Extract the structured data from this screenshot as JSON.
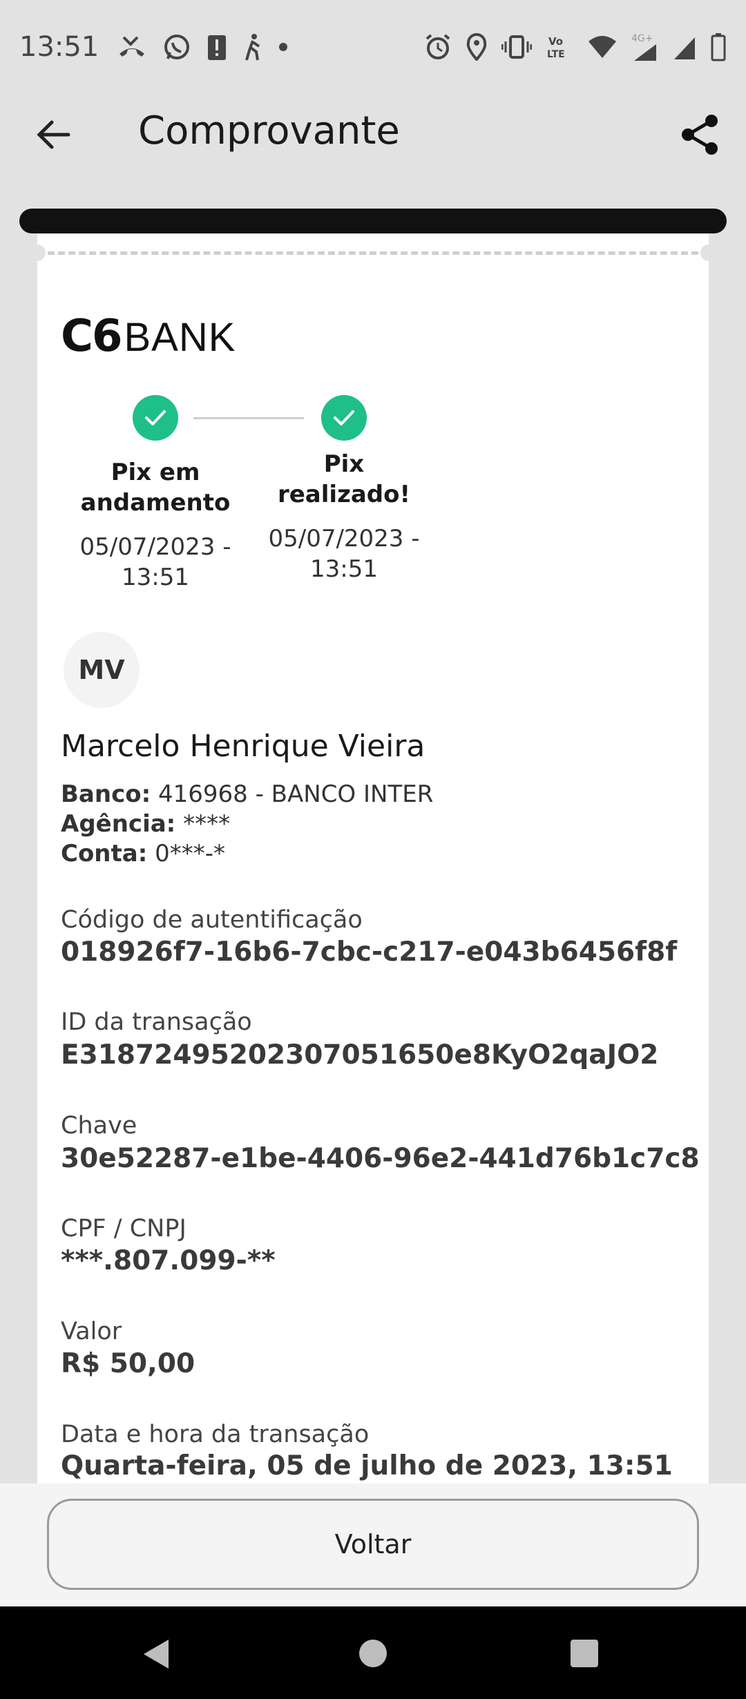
{
  "status_bar": {
    "time": "13:51",
    "left_icons": [
      "missed-call-icon",
      "whatsapp-icon",
      "alert-icon",
      "walking-icon",
      "dot-icon"
    ],
    "right_icons": [
      "alarm-icon",
      "location-icon",
      "vibrate-icon",
      "volte-icon",
      "wifi-icon",
      "signal-4g-icon",
      "signal-icon",
      "battery-icon"
    ],
    "volte_text": "Vo\nLTE",
    "network_text": "4G+"
  },
  "app_bar": {
    "title": "Comprovante",
    "back_icon": "arrow-left-icon",
    "share_icon": "share-icon"
  },
  "receipt": {
    "logo_c6": "C6",
    "logo_bank": "BANK",
    "steps": [
      {
        "label_line1": "Pix em",
        "label_line2": "andamento",
        "date_line1": "05/07/2023 -",
        "date_line2": "13:51"
      },
      {
        "label_line1": "Pix",
        "label_line2": "realizado!",
        "date_line1": "05/07/2023 -",
        "date_line2": "13:51"
      }
    ],
    "avatar_initials": "MV",
    "payee_name": "Marcelo Henrique Vieira",
    "bank": {
      "label": "Banco:",
      "value": "416968 - BANCO INTER"
    },
    "agency": {
      "label": "Agência:",
      "value": "****"
    },
    "account": {
      "label": "Conta:",
      "value": "0***-*"
    },
    "fields": [
      {
        "label": "Código de autentificação",
        "value": "018926f7-16b6-7cbc-c217-e043b6456f8f"
      },
      {
        "label": "ID da transação",
        "value": "E31872495202307051650e8KyO2qaJO2"
      },
      {
        "label": "Chave",
        "value": "30e52287-e1be-4406-96e2-441d76b1c7c8"
      },
      {
        "label": "CPF / CNPJ",
        "value": "***.807.099-**"
      },
      {
        "label": "Valor",
        "value": "R$ 50,00"
      },
      {
        "label": "Data e hora da transação",
        "value": "Quarta-feira, 05 de julho de 2023, 13:51"
      }
    ]
  },
  "footer": {
    "voltar_label": "Voltar"
  },
  "colors": {
    "success": "#1fbf8a",
    "background": "#e2e2e2",
    "card": "#ffffff"
  }
}
